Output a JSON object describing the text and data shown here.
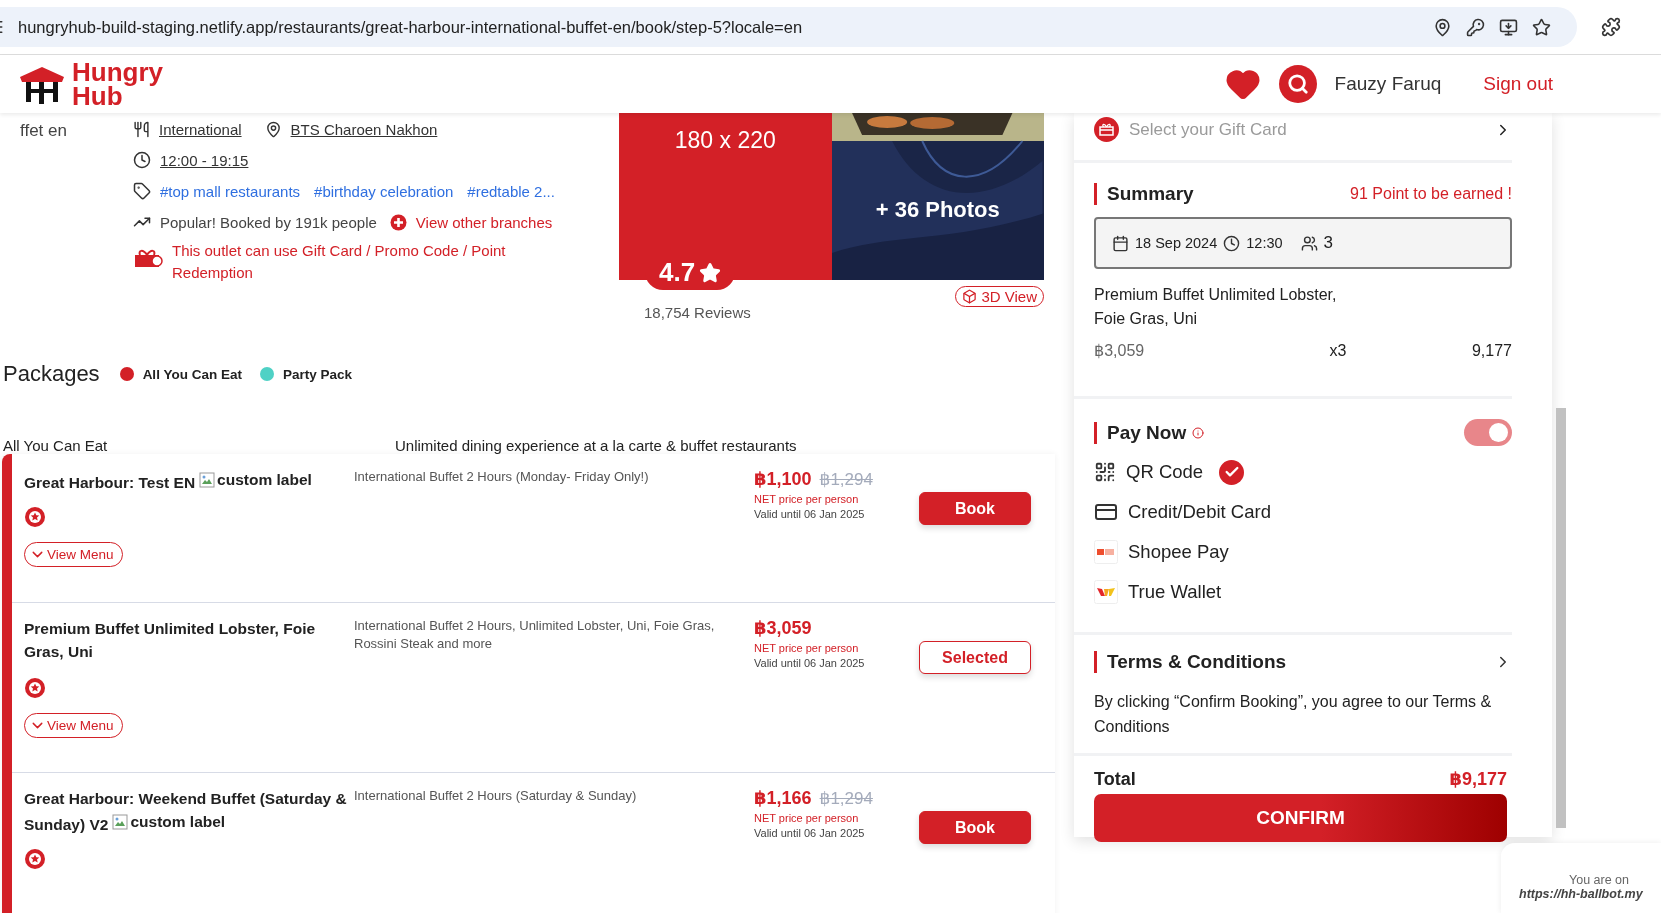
{
  "browser": {
    "url": "hungryhub-build-staging.netlify.app/restaurants/great-harbour-international-buffet-en/book/step-5?locale=en"
  },
  "header": {
    "logo": [
      "Hungry",
      "Hub"
    ],
    "user_name": "Fauzy Faruq",
    "sign_out": "Sign out"
  },
  "restaurant": {
    "name_fragment": "ffet en",
    "cuisine": "International",
    "location": "BTS Charoen Nakhon",
    "hours": "12:00 - 19:15",
    "tags": [
      "#top mall restaurants",
      "#birthday celebration",
      "#redtable 2..."
    ],
    "popularity": "Popular! Booked by 191k people",
    "branches_link": "View other branches",
    "promo_note": "This outlet can use Gift Card / Promo Code / Point Redemption"
  },
  "gallery": {
    "placeholder_label": "180 x 220",
    "photos_label": "+ 36 Photos",
    "rating": "4.7",
    "reviews": "18,754 Reviews",
    "view_3d": "3D View"
  },
  "packages": {
    "title": "Packages",
    "types": [
      {
        "label": "All You Can Eat",
        "color": "#d32027"
      },
      {
        "label": "Party Pack",
        "color": "#4fd1c5"
      }
    ],
    "category": {
      "name": "All You Can Eat",
      "description": "Unlimited dining experience at a la carte & buffet restaurants"
    },
    "items": [
      {
        "name": "Great Harbour: Test EN",
        "image_alt": "custom label",
        "description": "International Buffet 2 Hours (Monday- Friday Only!)",
        "price": "฿1,100",
        "original_price": "฿1,294",
        "price_note": "NET price per person",
        "valid_until": "Valid until 06 Jan 2025",
        "button": "Book",
        "selected": false,
        "view_menu": "View Menu"
      },
      {
        "name": "Premium Buffet Unlimited Lobster, Foie Gras, Uni",
        "description": "International Buffet 2 Hours, Unlimited Lobster, Uni, Foie Gras, Rossini Steak and more",
        "price": "฿3,059",
        "price_note": "NET price per person",
        "valid_until": "Valid until 06 Jan 2025",
        "button": "Selected",
        "selected": true,
        "view_menu": "View Menu"
      },
      {
        "name": "Great Harbour: Weekend Buffet (Saturday & Sunday) V2",
        "image_alt": "custom label",
        "description": "International Buffet 2 Hours (Saturday & Sunday)",
        "price": "฿1,166",
        "original_price": "฿1,294",
        "price_note": "NET price per person",
        "valid_until": "Valid until 06 Jan 2025",
        "button": "Book",
        "selected": false
      }
    ]
  },
  "booking": {
    "gift_card_placeholder": "Select your Gift Card",
    "summary_title": "Summary",
    "points": "91 Point to be earned !",
    "date": "18 Sep 2024",
    "time": "12:30",
    "guests": "3",
    "item_name": "Premium Buffet Unlimited Lobster, Foie Gras, Uni",
    "unit_price": "฿3,059",
    "quantity": "x3",
    "line_total": "9,177",
    "pay_now": {
      "title": "Pay Now",
      "on": true,
      "methods": [
        {
          "label": "QR Code",
          "kind": "qr",
          "selected": true
        },
        {
          "label": "Credit/Debit Card",
          "kind": "card",
          "selected": false
        },
        {
          "label": "Shopee Pay",
          "kind": "shopee",
          "selected": false
        },
        {
          "label": "True Wallet",
          "kind": "truewallet",
          "selected": false
        }
      ]
    },
    "terms_title": "Terms & Conditions",
    "terms_text": "By clicking “Confirm Booking”, you agree to our Terms & Conditions",
    "total_label": "Total",
    "total": "฿9,177",
    "confirm": "CONFIRM"
  },
  "chat_popup": {
    "line_1": "You are on",
    "line_2": "https://hh-ballbot.my"
  }
}
